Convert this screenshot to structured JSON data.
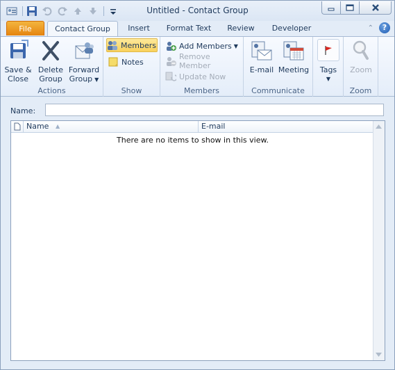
{
  "window": {
    "title": "Untitled  -  Contact Group"
  },
  "tabs": {
    "file": "File",
    "items": [
      "Contact Group",
      "Insert",
      "Format Text",
      "Review",
      "Developer"
    ],
    "active": "Contact Group"
  },
  "ribbon": {
    "actions": {
      "label": "Actions",
      "save_close": [
        "Save &",
        "Close"
      ],
      "delete_group": [
        "Delete",
        "Group"
      ],
      "forward_group": [
        "Forward",
        "Group"
      ]
    },
    "show": {
      "label": "Show",
      "members": "Members",
      "notes": "Notes"
    },
    "members": {
      "label": "Members",
      "add_members": "Add Members",
      "remove_member": "Remove Member",
      "update_now": "Update Now"
    },
    "communicate": {
      "label": "Communicate",
      "email": "E-mail",
      "meeting": "Meeting"
    },
    "tags": {
      "label": "Tags"
    },
    "zoom": {
      "label": "Zoom",
      "zoom_button": "Zoom"
    }
  },
  "form": {
    "name_label": "Name:",
    "name_value": ""
  },
  "list": {
    "columns": [
      "Name",
      "E-mail"
    ],
    "empty_message": "There are no items to show in this view."
  },
  "colors": {
    "file_tab": "#e5840f",
    "ribbon_bg": "#e4edf9",
    "selected_button": "#f9d15c",
    "text": "#1e395b"
  }
}
